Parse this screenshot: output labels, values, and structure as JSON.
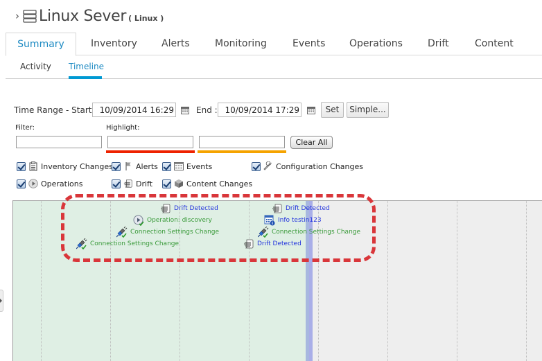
{
  "header": {
    "breadcrumb_chevron": "›",
    "resource_icon": "server-stack-icon",
    "title": "Linux Sever",
    "subtitle": "( Linux )"
  },
  "main_tabs": [
    {
      "label": "Summary",
      "active": true
    },
    {
      "label": "Inventory"
    },
    {
      "label": "Alerts"
    },
    {
      "label": "Monitoring"
    },
    {
      "label": "Events"
    },
    {
      "label": "Operations"
    },
    {
      "label": "Drift"
    },
    {
      "label": "Content"
    }
  ],
  "sub_tabs": [
    {
      "label": "Activity"
    },
    {
      "label": "Timeline",
      "active": true
    }
  ],
  "time_range": {
    "start_label": "Time Range - Start :",
    "start_value": "10/09/2014 16:29",
    "end_label": "End :",
    "end_value": "10/09/2014 17:29",
    "set_label": "Set",
    "simple_label": "Simple..."
  },
  "filter": {
    "filter_label": "Filter:",
    "filter_value": "",
    "highlight_label": "Highlight:",
    "highlight1_value": "",
    "highlight1_color": "#ee2200",
    "highlight2_value": "",
    "highlight2_color": "#f5a300",
    "clear_label": "Clear All"
  },
  "checkboxes": [
    {
      "label": "Inventory Changes",
      "icon": "clipboard-icon",
      "checked": true
    },
    {
      "label": "Alerts",
      "icon": "flag-icon",
      "checked": true
    },
    {
      "label": "Events",
      "icon": "grid-calendar-icon",
      "checked": true
    },
    {
      "label": "Configuration Changes",
      "icon": "wrench-icon",
      "checked": true
    },
    {
      "label": "Operations",
      "icon": "play-circle-icon",
      "checked": true
    },
    {
      "label": "Drift",
      "icon": "drift-doc-icon",
      "checked": true
    },
    {
      "label": "Content Changes",
      "icon": "package-cube-icon",
      "checked": true
    }
  ],
  "timeline": {
    "colors": {
      "active_region": "#dfefe4",
      "inactive_region": "#eeeeee",
      "now_band": "#a9b2e3",
      "annotation": "#d9363a"
    },
    "events": [
      {
        "label": "Drift Detected",
        "type": "drift",
        "color": "#2233dd"
      },
      {
        "label": "Operation: discovery",
        "type": "operation",
        "color": "#3a9a3a"
      },
      {
        "label": "Connection Settings Change",
        "type": "connection",
        "color": "#3a9a3a"
      },
      {
        "label": "Connection Settings Change",
        "type": "connection",
        "color": "#3a9a3a"
      },
      {
        "label": "Drift Detected",
        "type": "drift",
        "color": "#2233dd"
      },
      {
        "label": "Info testin123",
        "type": "event-info",
        "color": "#2233dd"
      },
      {
        "label": "Connection Settings Change",
        "type": "connection",
        "color": "#3a9a3a"
      },
      {
        "label": "Drift Detected",
        "type": "drift",
        "color": "#2233dd"
      }
    ]
  }
}
